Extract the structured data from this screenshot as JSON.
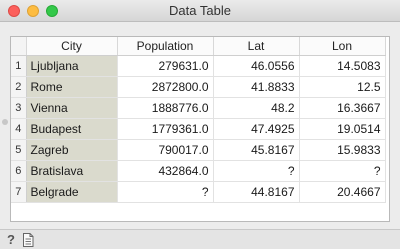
{
  "window": {
    "title": "Data Table"
  },
  "table": {
    "headers": [
      "City",
      "Population",
      "Lat",
      "Lon"
    ],
    "rows": [
      {
        "num": "1",
        "city": "Ljubljana",
        "population": "279631.0",
        "lat": "46.0556",
        "lon": "14.5083"
      },
      {
        "num": "2",
        "city": "Rome",
        "population": "2872800.0",
        "lat": "41.8833",
        "lon": "12.5"
      },
      {
        "num": "3",
        "city": "Vienna",
        "population": "1888776.0",
        "lat": "48.2",
        "lon": "16.3667"
      },
      {
        "num": "4",
        "city": "Budapest",
        "population": "1779361.0",
        "lat": "47.4925",
        "lon": "19.0514"
      },
      {
        "num": "5",
        "city": "Zagreb",
        "population": "790017.0",
        "lat": "45.8167",
        "lon": "15.9833"
      },
      {
        "num": "6",
        "city": "Bratislava",
        "population": "432864.0",
        "lat": "?",
        "lon": "?"
      },
      {
        "num": "7",
        "city": "Belgrade",
        "population": "?",
        "lat": "44.8167",
        "lon": "20.4667"
      }
    ]
  },
  "statusbar": {
    "help_glyph": "?",
    "icons": [
      "help-icon",
      "report-icon"
    ]
  },
  "colors": {
    "meta_column_bg": "#dadacd"
  }
}
